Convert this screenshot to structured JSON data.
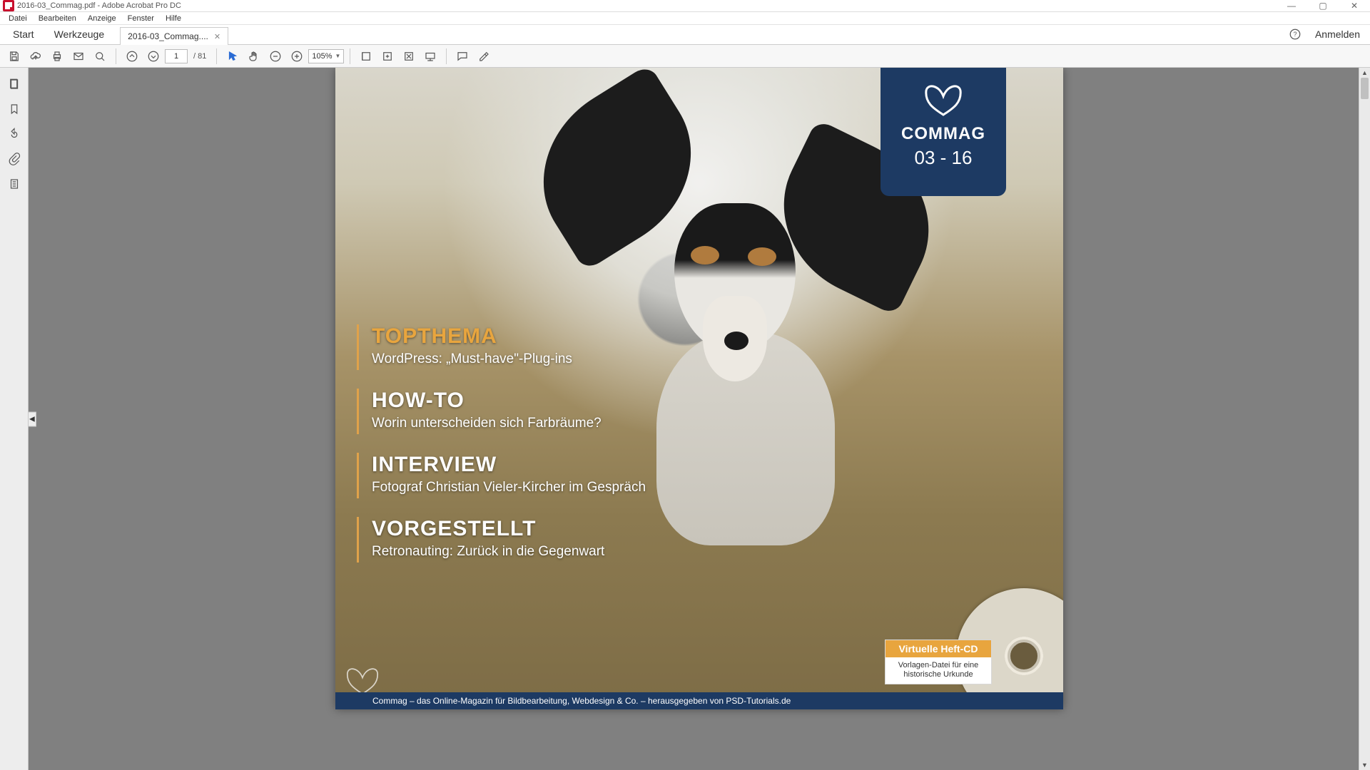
{
  "window": {
    "title": "2016-03_Commag.pdf - Adobe Acrobat Pro DC"
  },
  "menubar": [
    "Datei",
    "Bearbeiten",
    "Anzeige",
    "Fenster",
    "Hilfe"
  ],
  "tabs": {
    "start": "Start",
    "tools": "Werkzeuge",
    "doc": "2016-03_Commag....",
    "login": "Anmelden"
  },
  "toolbar": {
    "page_current": "1",
    "page_total": "/ 81",
    "zoom": "105%"
  },
  "cover": {
    "badge_title": "COMMAG",
    "badge_issue": "03 - 16",
    "sections": [
      {
        "h": "TOPTHEMA",
        "s": "WordPress: „Must-have\"-Plug-ins"
      },
      {
        "h": "HOW-TO",
        "s": "Worin unterscheiden sich Farbräume?"
      },
      {
        "h": "INTERVIEW",
        "s": "Fotograf Christian Vieler-Kircher im Gespräch"
      },
      {
        "h": "VORGESTELLT",
        "s": "Retronauting: Zurück in die Gegenwart"
      }
    ],
    "cd_title": "Virtuelle Heft-CD",
    "cd_body": "Vorlagen-Datei für eine historische Urkunde",
    "footer": "Commag – das Online-Magazin für Bildbearbeitung, Webdesign & Co. – herausgegeben von PSD-Tutorials.de"
  }
}
